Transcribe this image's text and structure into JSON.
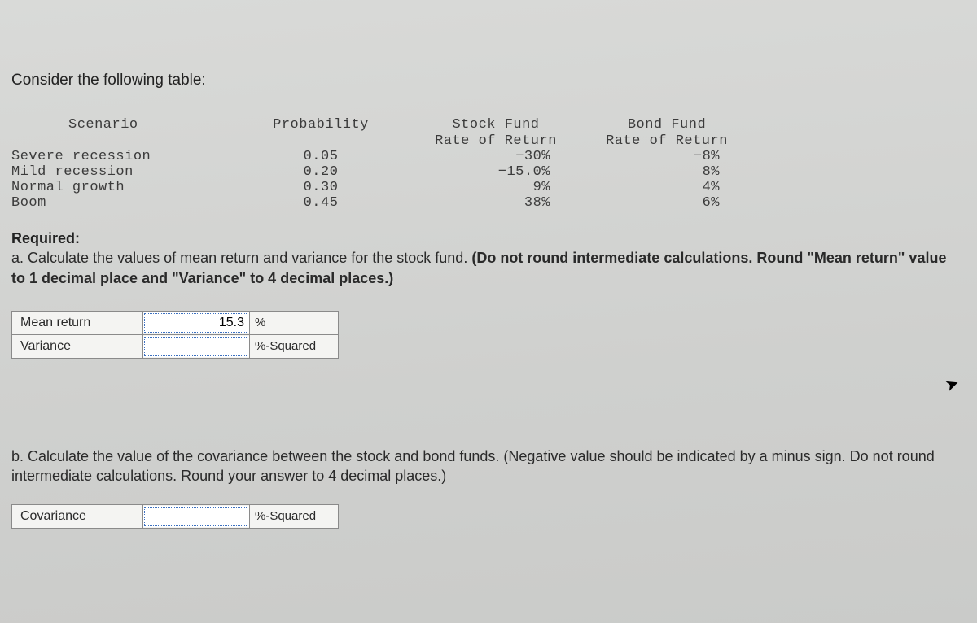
{
  "intro": "Consider the following table:",
  "table": {
    "headers": {
      "scenario": "Scenario",
      "probability": "Probability",
      "stock_line1": "Stock Fund",
      "stock_line2": "Rate of Return",
      "bond_line1": "Bond Fund",
      "bond_line2": "Rate of Return"
    },
    "rows": [
      {
        "scenario": "Severe recession",
        "p": "0.05",
        "stock": "−30%",
        "bond": "−8%"
      },
      {
        "scenario": "Mild recession",
        "p": "0.20",
        "stock": "−15.0%",
        "bond": "8%"
      },
      {
        "scenario": "Normal growth",
        "p": "0.30",
        "stock": "9%",
        "bond": "4%"
      },
      {
        "scenario": "Boom",
        "p": "0.45",
        "stock": "38%",
        "bond": "6%"
      }
    ]
  },
  "required": {
    "label": "Required:",
    "a_prefix": "a. ",
    "a_text": "Calculate the values of mean return and variance for the stock fund. ",
    "a_bold": "(Do not round intermediate calculations. Round \"Mean return\" value to 1 decimal place and \"Variance\" to 4 decimal places.)"
  },
  "answers_a": {
    "mean_label": "Mean return",
    "mean_value": "15.3",
    "mean_unit": "%",
    "var_label": "Variance",
    "var_value": "",
    "var_unit": "%-Squared"
  },
  "part_b": {
    "prefix": "b. ",
    "text": "Calculate the value of the covariance between the stock and bond funds. ",
    "bold": "(Negative value should be indicated by a minus sign. Do not round intermediate calculations. Round your answer to 4 decimal places.)"
  },
  "answers_b": {
    "cov_label": "Covariance",
    "cov_value": "",
    "cov_unit": "%-Squared"
  }
}
